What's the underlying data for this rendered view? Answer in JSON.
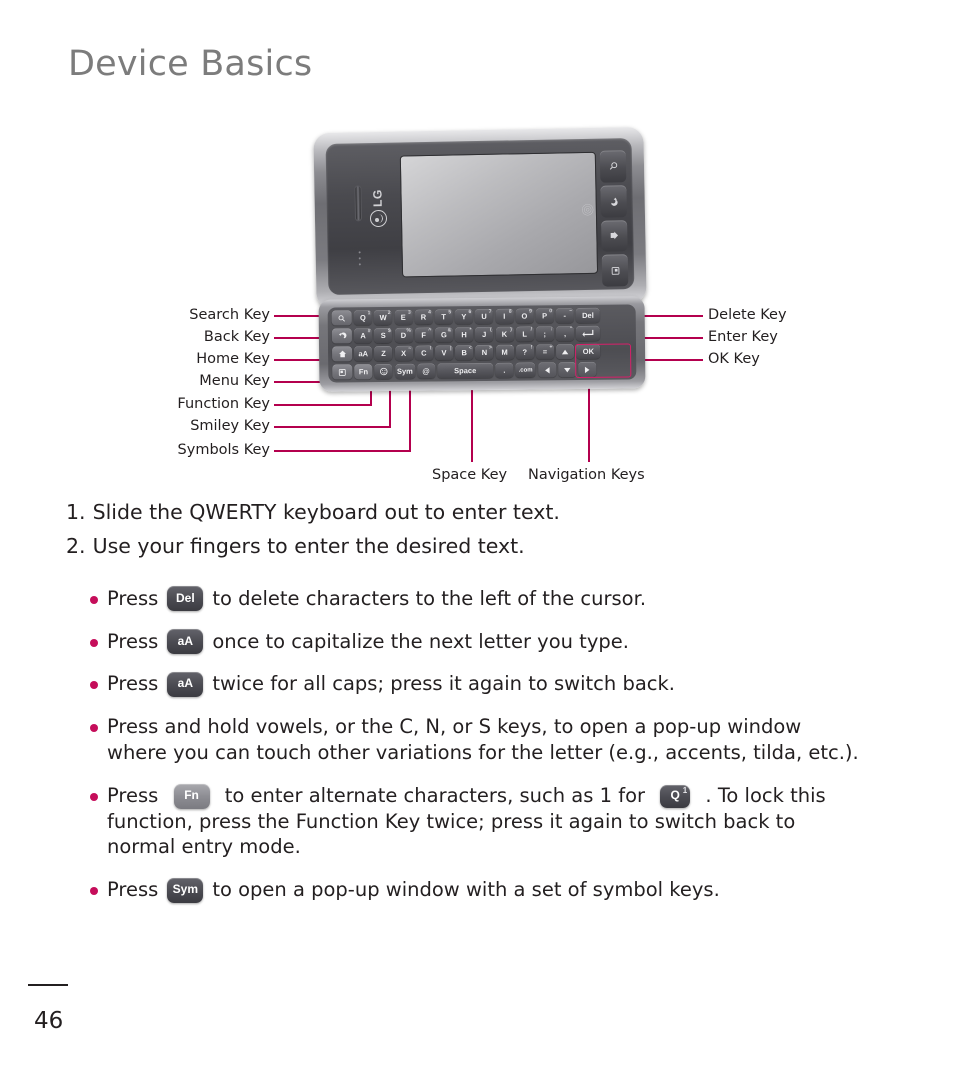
{
  "document": {
    "title": "Device Basics",
    "page_number": "46"
  },
  "colors": {
    "title_gray": "#7c7c7c",
    "leader_line": "#b4004e",
    "bullet_dot": "#c50d5a",
    "nav_highlight": "#d91f6a",
    "body_text": "#231f20"
  },
  "figure": {
    "labels_left": [
      {
        "text": "Search Key"
      },
      {
        "text": "Back Key"
      },
      {
        "text": "Home Key"
      },
      {
        "text": "Menu Key"
      },
      {
        "text": "Function Key"
      },
      {
        "text": "Smiley Key"
      },
      {
        "text": "Symbols Key"
      }
    ],
    "labels_right": [
      {
        "text": "Delete Key"
      },
      {
        "text": "Enter Key"
      },
      {
        "text": "OK Key"
      }
    ],
    "labels_bottom": [
      {
        "text": "Space Key"
      },
      {
        "text": "Navigation Keys"
      }
    ],
    "phone": {
      "brand": "LG",
      "side_buttons": [
        "search-icon",
        "back-icon",
        "home-icon",
        "menu-icon"
      ]
    },
    "keyboard": {
      "row1": [
        {
          "label": "search-icon",
          "icon": "search",
          "type": "fn"
        },
        {
          "label": "Q",
          "sup": "1"
        },
        {
          "label": "W",
          "sup": "2"
        },
        {
          "label": "E",
          "sup": "3"
        },
        {
          "label": "R",
          "sup": "4"
        },
        {
          "label": "T",
          "sup": "5"
        },
        {
          "label": "Y",
          "sup": "6"
        },
        {
          "label": "U",
          "sup": "7"
        },
        {
          "label": "I",
          "sup": "8"
        },
        {
          "label": "O",
          "sup": "9"
        },
        {
          "label": "P",
          "sup": "0"
        },
        {
          "label": "-",
          "sup": "~"
        },
        {
          "label": "Del"
        }
      ],
      "row2": [
        {
          "label": "back-icon",
          "icon": "back",
          "type": "fn"
        },
        {
          "label": "A",
          "sup": "#"
        },
        {
          "label": "S",
          "sup": "$"
        },
        {
          "label": "D",
          "sup": "%"
        },
        {
          "label": "F",
          "sup": "^"
        },
        {
          "label": "G",
          "sup": "&"
        },
        {
          "label": "H",
          "sup": "*"
        },
        {
          "label": "J",
          "sup": "("
        },
        {
          "label": "K",
          "sup": ")"
        },
        {
          "label": "L",
          "sup": "/"
        },
        {
          "label": ";",
          "sup": ":"
        },
        {
          "label": ",",
          "sup": "\""
        },
        {
          "label": "enter-icon",
          "icon": "enter"
        }
      ],
      "row3": [
        {
          "label": "home-icon",
          "icon": "home",
          "type": "fn"
        },
        {
          "label": "aA"
        },
        {
          "label": "Z"
        },
        {
          "label": "X",
          "sup": "~"
        },
        {
          "label": "C",
          "sup": "\\"
        },
        {
          "label": "V",
          "sup": "|"
        },
        {
          "label": "B",
          "sup": "<"
        },
        {
          "label": "N",
          "sup": ">"
        },
        {
          "label": "M",
          "sup": "`"
        },
        {
          "label": "?",
          "sup": "!"
        },
        {
          "label": "=",
          "sup": "+"
        },
        {
          "label": "up-arrow-icon",
          "icon": "up"
        },
        {
          "label": "OK"
        }
      ],
      "row4": [
        {
          "label": "menu-icon",
          "icon": "menu",
          "type": "fn"
        },
        {
          "label": "Fn",
          "type": "fn"
        },
        {
          "label": "smiley-icon",
          "icon": "smiley"
        },
        {
          "label": "Sym"
        },
        {
          "label": "@"
        },
        {
          "label": "Space"
        },
        {
          "label": "."
        },
        {
          "label": ".com"
        },
        {
          "label": "left-arrow-icon",
          "icon": "left"
        },
        {
          "label": "down-arrow-icon",
          "icon": "down"
        },
        {
          "label": "right-arrow-icon",
          "icon": "right"
        }
      ]
    }
  },
  "steps": [
    {
      "num": "1.",
      "text": "Slide the QWERTY keyboard out to enter text."
    },
    {
      "num": "2.",
      "text": "Use your fingers to enter the desired text."
    }
  ],
  "bullets": [
    {
      "pre": "Press",
      "key": "Del",
      "key_style": "dark",
      "post": "to delete characters to the left of the cursor."
    },
    {
      "pre": "Press",
      "key": "aA",
      "key_style": "dark",
      "post": "once to capitalize the next letter you type."
    },
    {
      "pre": "Press",
      "key": "aA",
      "key_style": "dark",
      "post": "twice for all caps; press it again to switch back."
    },
    {
      "text_line1": "Press and hold vowels, or the C, N, or S keys, to open a pop-up window",
      "text_line2": "where you can touch other variations for the letter (e.g., accents, tilda, etc.)."
    },
    {
      "pre": "Press",
      "key": "Fn",
      "key_style": "light",
      "mid": "to enter alternate characters, such as 1 for",
      "key2": "Q",
      "key2_sup": "1",
      "post": ". To lock this",
      "line2": "function, press the Function Key twice; press it again to switch back to",
      "line3": "normal entry mode."
    },
    {
      "pre": "Press",
      "key": "Sym",
      "key_style": "dark",
      "post": "to open a pop-up window with a set of symbol keys."
    }
  ]
}
